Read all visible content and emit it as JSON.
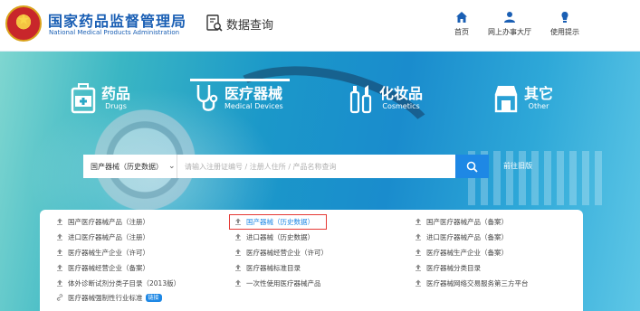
{
  "header": {
    "brand_cn": "国家药品监督管理局",
    "brand_en": "National Medical Products Administration",
    "db_query": "数据查询",
    "nav": [
      {
        "label": "首页",
        "icon": "home-icon"
      },
      {
        "label": "网上办事大厅",
        "icon": "user-icon"
      },
      {
        "label": "使用提示",
        "icon": "lightbulb-icon"
      }
    ]
  },
  "categories": [
    {
      "cn": "药品",
      "en": "Drugs",
      "icon": "medicine-box-icon"
    },
    {
      "cn": "医疗器械",
      "en": "Medical Devices",
      "icon": "stethoscope-icon"
    },
    {
      "cn": "化妆品",
      "en": "Cosmetics",
      "icon": "cosmetics-icon"
    },
    {
      "cn": "其它",
      "en": "Other",
      "icon": "store-icon"
    }
  ],
  "search": {
    "selected": "国产器械（历史数据）",
    "placeholder": "请输入注册证编号 / 注册人住所 / 产品名称查询",
    "old_link": "前往旧版"
  },
  "links": {
    "col1": [
      "国产医疗器械产品（注册）",
      "进口医疗器械产品（注册）",
      "医疗器械生产企业（许可）",
      "医疗器械经营企业（备案）",
      "体外诊断试剂分类子目录（2013版）",
      "医疗器械强制性行业标准"
    ],
    "col2": [
      "国产器械（历史数据）",
      "进口器械（历史数据）",
      "医疗器械经营企业（许可）",
      "医疗器械标准目录",
      "一次性使用医疗器械产品"
    ],
    "col3": [
      "国产医疗器械产品（备案）",
      "进口医疗器械产品（备案）",
      "医疗器械生产企业（备案）",
      "医疗器械分类目录",
      "医疗器械网络交易服务第三方平台"
    ],
    "badge": "链接"
  },
  "colors": {
    "brand": "#1a5fb4",
    "accent": "#1e88e5",
    "highlight": "#e53935"
  }
}
